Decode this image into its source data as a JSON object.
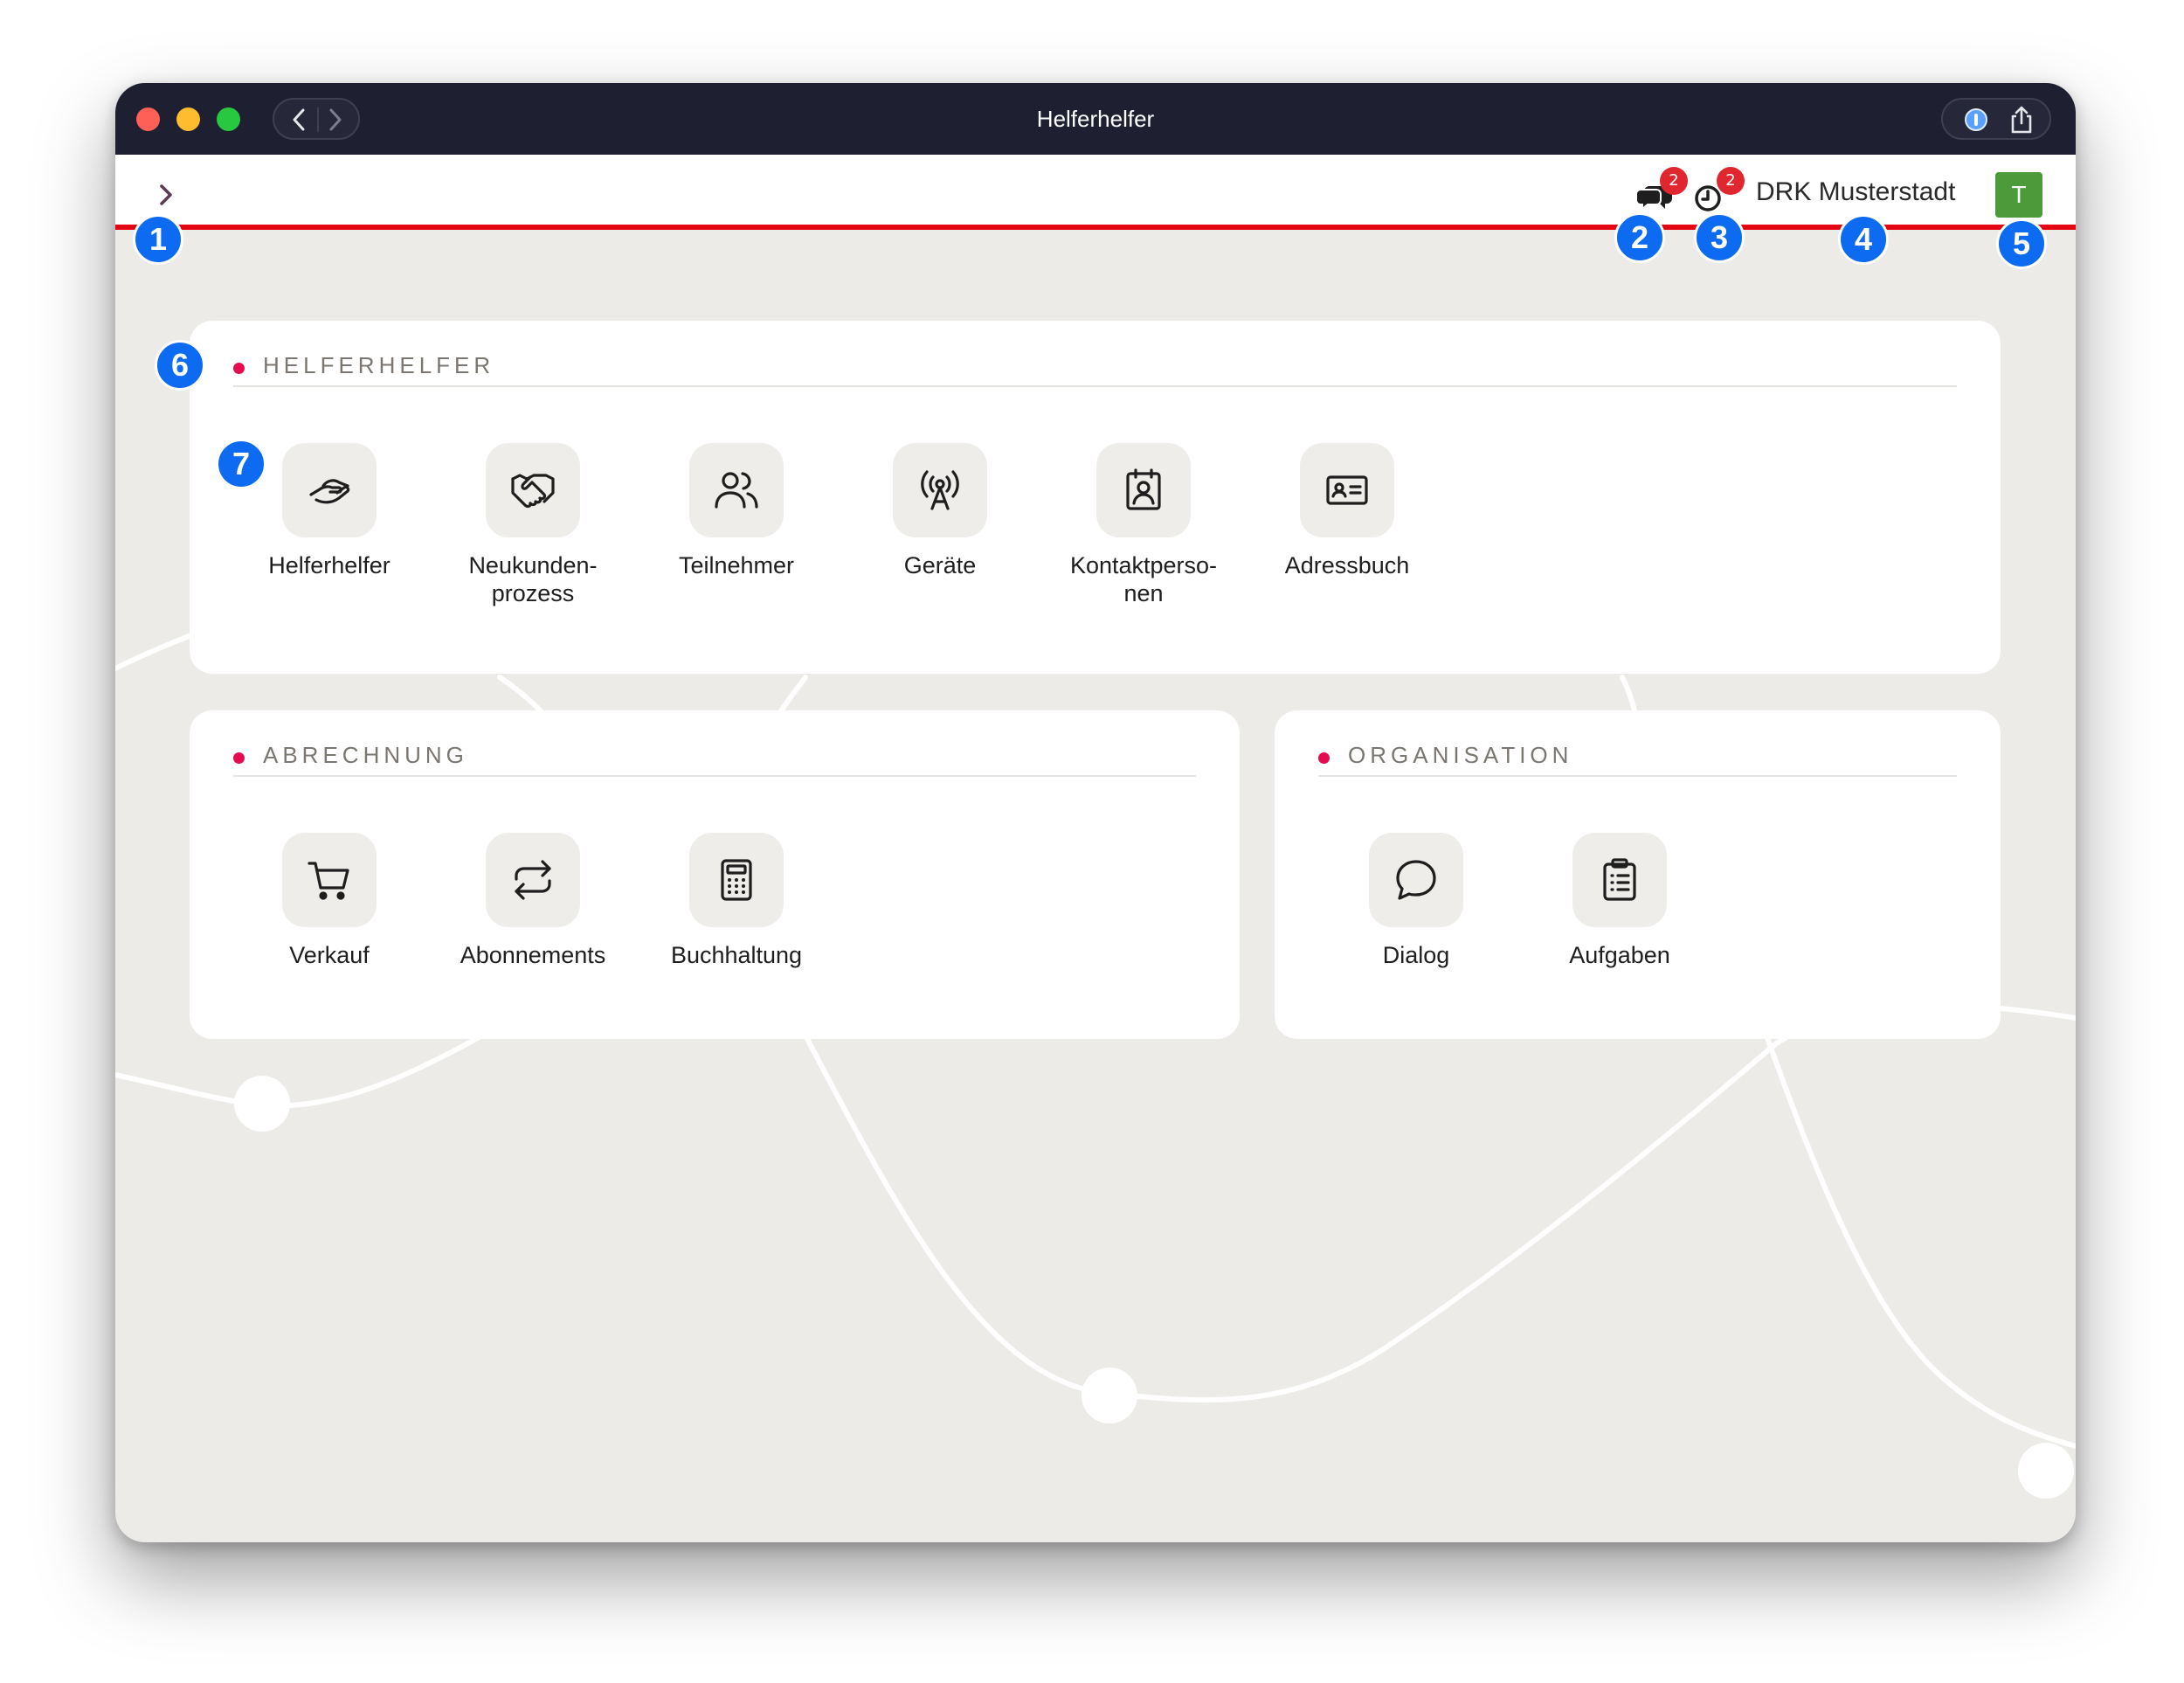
{
  "window": {
    "title": "Helferhelfer"
  },
  "header": {
    "messages_badge": "2",
    "tasks_badge": "2",
    "organization_name": "DRK Musterstadt",
    "avatar_initial": "T"
  },
  "annotations": [
    "1",
    "2",
    "3",
    "4",
    "5",
    "6",
    "7"
  ],
  "sections": {
    "helferhelfer": {
      "title": "HELFERHELFER",
      "tiles": [
        {
          "label": "Helferhelfer",
          "icon": "handshake-hand-icon"
        },
        {
          "label": "Neukunden-\nprozess",
          "icon": "handshake-icon"
        },
        {
          "label": "Teilnehmer",
          "icon": "users-icon"
        },
        {
          "label": "Geräte",
          "icon": "antenna-icon"
        },
        {
          "label": "Kontaktperso-\nnen",
          "icon": "contact-book-icon"
        },
        {
          "label": "Adressbuch",
          "icon": "id-card-icon"
        }
      ]
    },
    "abrechnung": {
      "title": "ABRECHNUNG",
      "tiles": [
        {
          "label": "Verkauf",
          "icon": "shopping-cart-icon"
        },
        {
          "label": "Abonnements",
          "icon": "repeat-arrows-icon"
        },
        {
          "label": "Buchhaltung",
          "icon": "calculator-icon"
        }
      ]
    },
    "organisation": {
      "title": "ORGANISATION",
      "tiles": [
        {
          "label": "Dialog",
          "icon": "chat-bubble-icon"
        },
        {
          "label": "Aufgaben",
          "icon": "clipboard-list-icon"
        }
      ]
    }
  },
  "colors": {
    "titlebar": "#1e2031",
    "accent_red": "#e30613",
    "section_dot": "#e40c4e",
    "background": "#edebe8",
    "avatar": "#4c9a3a",
    "badge": "#e0262f",
    "annotation_marker": "#0d6bf2"
  }
}
